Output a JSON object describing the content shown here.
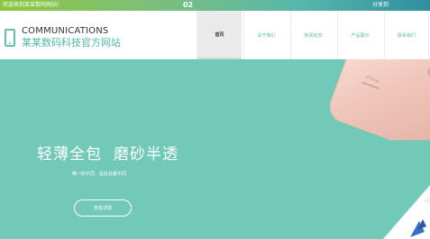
{
  "topbar": {
    "welcome": "欢迎来到某某数码网站！",
    "slide_number": "02",
    "share": "分享到"
  },
  "header": {
    "brand_en": "COMMUNICATIONS",
    "brand_cn": "某某数码科技官方网站",
    "logo_icon": "phone-icon"
  },
  "nav": {
    "items": [
      {
        "label": "首页",
        "active": true
      },
      {
        "label": "关于我们",
        "active": false
      },
      {
        "label": "新闻动态",
        "active": false
      },
      {
        "label": "产品展示",
        "active": false
      },
      {
        "label": "联系我们",
        "active": false
      }
    ]
  },
  "hero": {
    "slogan_part1": "轻薄全包",
    "slogan_part2": "磨砂半透",
    "subtitle": "唯一的不同　是处处都不同",
    "button_label": "查看详情",
    "background_color": "#73c9b7",
    "phone_model_text": "iPhone"
  },
  "colors": {
    "accent": "#5fb9ac",
    "topbar_start": "#8dc63f",
    "topbar_end": "#2f8f9d"
  }
}
